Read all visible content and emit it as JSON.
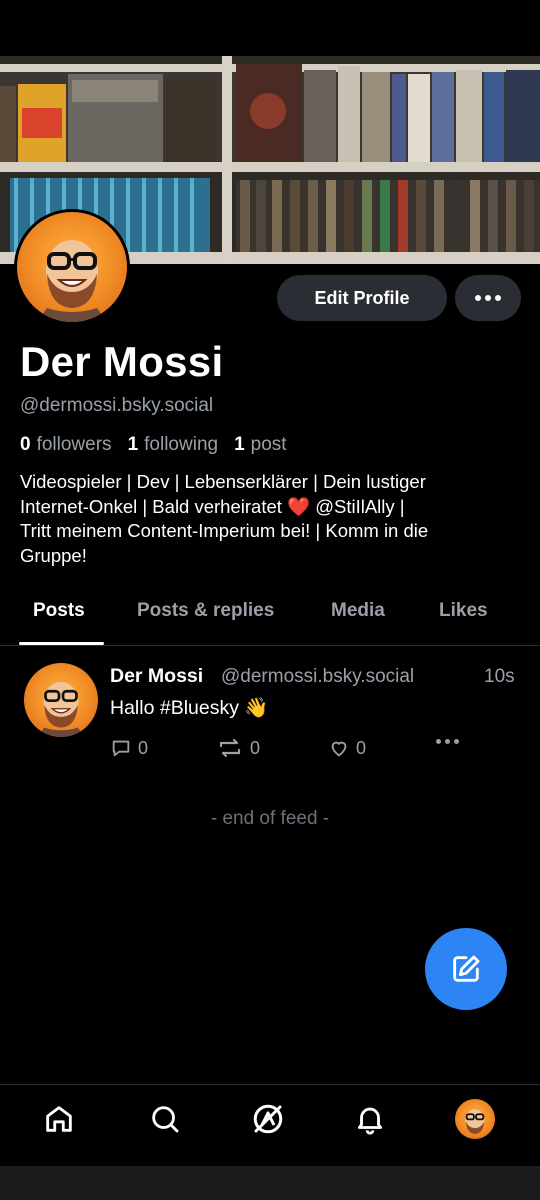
{
  "banner": {
    "label": "Profile banner - bookshelf with games"
  },
  "profile": {
    "display_name": "Der Mossi",
    "handle": "@dermossi.bsky.social",
    "followers_count": "0",
    "followers_label": "followers",
    "following_count": "1",
    "following_label": "following",
    "posts_count": "1",
    "posts_label": "post",
    "bio_line1": "Videospieler | Dev | Lebenserklärer | Dein lustiger",
    "bio_line2": "Internet-Onkel | Bald verheiratet ❤️ @StiIlAlly |",
    "bio_line3": "Tritt meinem Content-Imperium bei! | Komm in die",
    "bio_line4": "Gruppe!"
  },
  "actions": {
    "edit_profile": "Edit Profile"
  },
  "tabs": [
    {
      "label": "Posts",
      "active": true
    },
    {
      "label": "Posts & replies",
      "active": false
    },
    {
      "label": "Media",
      "active": false
    },
    {
      "label": "Likes",
      "active": false
    }
  ],
  "post": {
    "author": "Der Mossi",
    "handle": "@dermossi.bsky.social",
    "time": "10s",
    "text": "Hallo #Bluesky 👋",
    "reply_count": "0",
    "repost_count": "0",
    "like_count": "0"
  },
  "feed": {
    "end_text": "- end of feed -"
  },
  "nav": [
    "home-icon",
    "search-icon",
    "feeds-icon",
    "notifications-icon",
    "profile-avatar"
  ],
  "colors": {
    "accent": "#2d84f5",
    "muted": "#9aa0a8",
    "button_bg": "#2a2d33"
  }
}
